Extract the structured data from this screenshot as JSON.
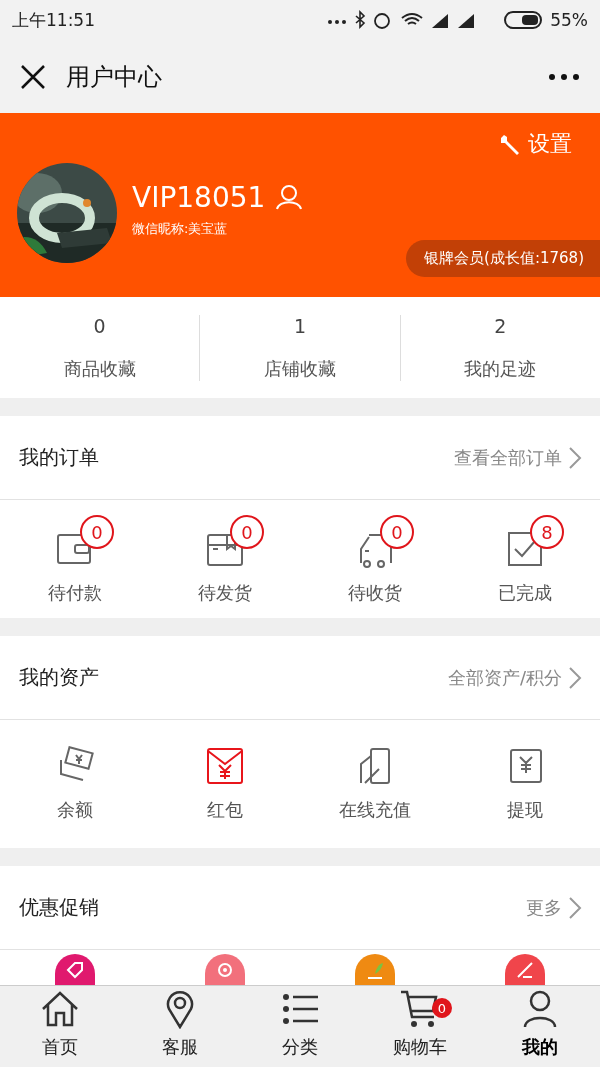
{
  "status_bar": {
    "time": "上午11:51",
    "battery": "55%"
  },
  "nav": {
    "title": "用户中心"
  },
  "profile": {
    "settings": "设置",
    "username": "VIP18051",
    "nickname": "微信昵称:美宝蓝",
    "level_badge": "银牌会员(成长值:1768)"
  },
  "stats": [
    {
      "count": "0",
      "label": "商品收藏"
    },
    {
      "count": "1",
      "label": "店铺收藏"
    },
    {
      "count": "2",
      "label": "我的足迹"
    }
  ],
  "orders": {
    "title": "我的订单",
    "link": "查看全部订单",
    "items": [
      {
        "kind": "wallet",
        "label": "待付款",
        "count": "0"
      },
      {
        "kind": "box",
        "label": "待发货",
        "count": "0"
      },
      {
        "kind": "truck",
        "label": "待收货",
        "count": "0"
      },
      {
        "kind": "check",
        "label": "已完成",
        "count": "8"
      }
    ]
  },
  "assets": {
    "title": "我的资产",
    "link": "全部资产/积分",
    "items": [
      {
        "kind": "cash",
        "label": "余额"
      },
      {
        "kind": "envelope",
        "label": "红包"
      },
      {
        "kind": "card",
        "label": "在线充值"
      },
      {
        "kind": "withdraw",
        "label": "提现"
      }
    ]
  },
  "promos": {
    "title": "优惠促销",
    "link": "更多",
    "items": [
      {
        "kind": "tag",
        "color": "#e0196e"
      },
      {
        "kind": "gear",
        "color": "#f2707c"
      },
      {
        "kind": "group",
        "color": "#ef8a12"
      },
      {
        "kind": "bargain",
        "color": "#f0454b"
      }
    ]
  },
  "tab_bar": [
    {
      "kind": "home",
      "label": "首页",
      "selected": false
    },
    {
      "kind": "pin",
      "label": "客服",
      "selected": false
    },
    {
      "kind": "list",
      "label": "分类",
      "selected": false
    },
    {
      "kind": "cart",
      "label": "购物车",
      "selected": false,
      "badge": "0"
    },
    {
      "kind": "user",
      "label": "我的",
      "selected": true
    }
  ]
}
